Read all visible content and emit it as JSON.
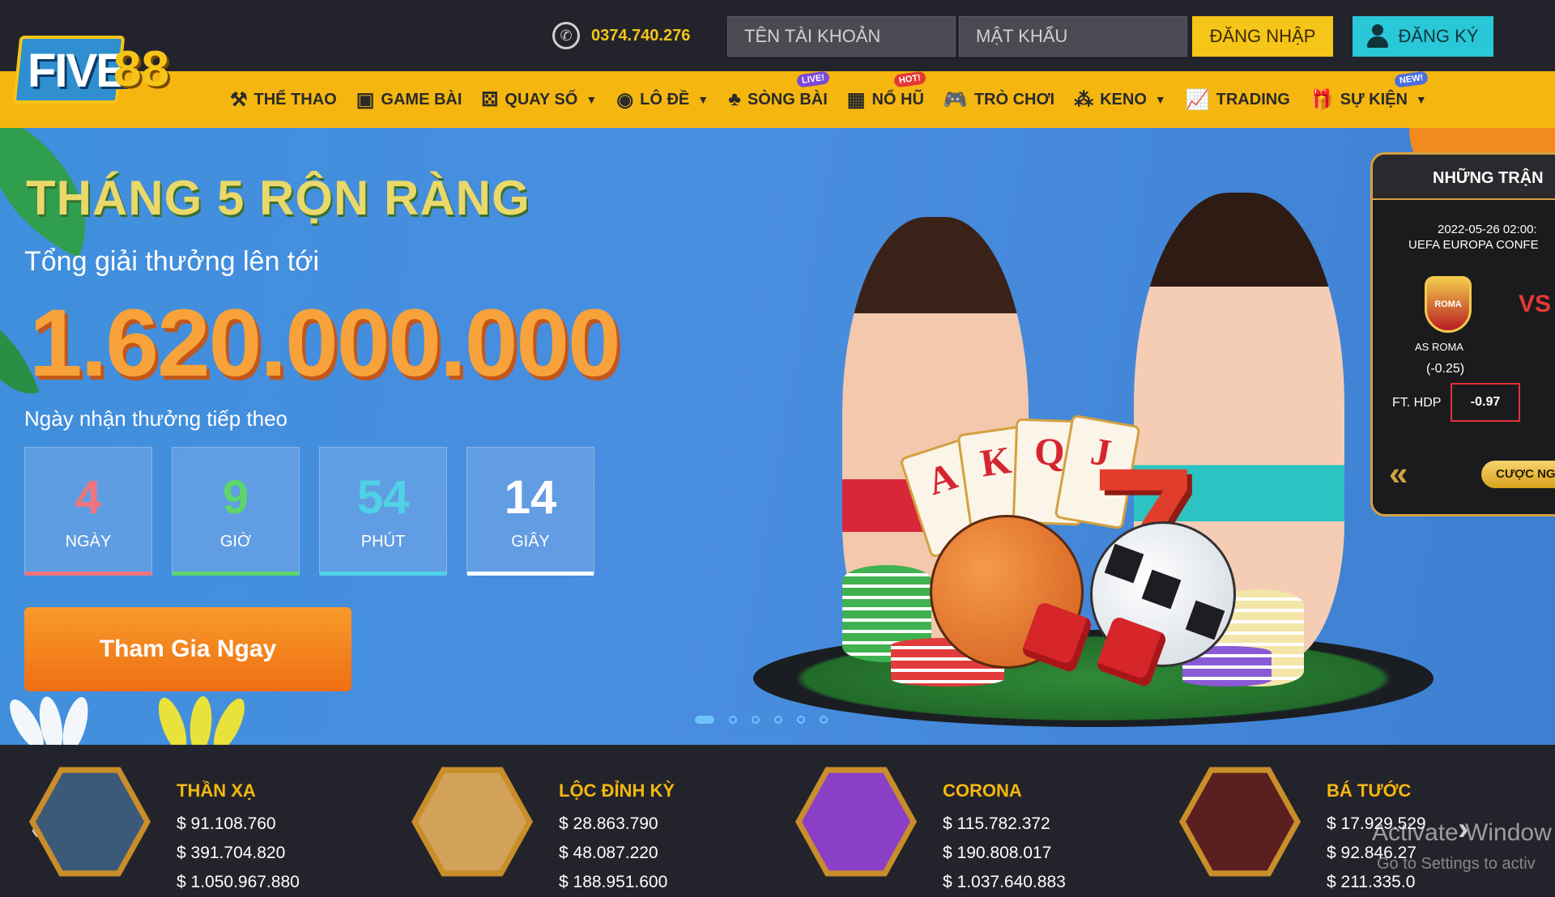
{
  "logo": {
    "part1": "FIVE",
    "part2": "88"
  },
  "header": {
    "phone": "0374.740.276",
    "username_placeholder": "TÊN TÀI KHOẢN",
    "password_placeholder": "MẬT KHẨU",
    "login_label": "ĐĂNG NHẬP",
    "register_label": "ĐĂNG KÝ"
  },
  "nav": {
    "items": [
      {
        "label": "THỂ THAO",
        "icon": "sports-icon"
      },
      {
        "label": "GAME BÀI",
        "icon": "card-games-icon"
      },
      {
        "label": "QUAY SỐ",
        "icon": "lottery-draw-icon"
      },
      {
        "label": "LÔ ĐỀ",
        "icon": "lotto-icon"
      },
      {
        "label": "SÒNG BÀI",
        "icon": "casino-icon",
        "badge": "LIVE!"
      },
      {
        "label": "NỔ HŨ",
        "icon": "slots-icon",
        "badge": "HOT!"
      },
      {
        "label": "TRÒ CHƠI",
        "icon": "gamepad-icon"
      },
      {
        "label": "KENO",
        "icon": "keno-icon"
      },
      {
        "label": "TRADING",
        "icon": "trading-chart-icon"
      },
      {
        "label": "SỰ KIỆN",
        "icon": "gift-icon",
        "badge": "NEW!"
      }
    ]
  },
  "promo": {
    "title": "THÁNG 5 RỘN RÀNG",
    "subtitle": "Tổng giải thưởng lên tới",
    "amount": "1.620.000.000",
    "next_label": "Ngày nhận thưởng tiếp theo",
    "countdown": [
      {
        "value": "4",
        "label": "NGÀY",
        "color": "#f0747c"
      },
      {
        "value": "9",
        "label": "GIỜ",
        "color": "#5cd66a"
      },
      {
        "value": "54",
        "label": "PHÚT",
        "color": "#4fd2e6"
      },
      {
        "value": "14",
        "label": "GIÂY",
        "color": "#ffffff"
      }
    ],
    "cta_label": "Tham Gia Ngay",
    "card_letters": [
      "A",
      "K",
      "Q",
      "J"
    ],
    "seven": "7"
  },
  "match": {
    "header": "NHỮNG TRẬN",
    "datetime": "2022-05-26 02:00:",
    "league": "UEFA EUROPA CONFE",
    "crest_text": "ROMA",
    "vs": "VS",
    "team_home": "AS ROMA",
    "handicap": "(-0.25)",
    "ft_label": "FT. HDP",
    "odds": "-0.97",
    "bet_label": "CƯỢC NG"
  },
  "jackpots": [
    {
      "name": "THẦN XẠ",
      "values": [
        "$ 91.108.760",
        "$ 391.704.820",
        "$ 1.050.967.880"
      ],
      "color": "#3b5a7a"
    },
    {
      "name": "LỘC ĐỈNH KỲ",
      "values": [
        "$ 28.863.790",
        "$ 48.087.220",
        "$ 188.951.600"
      ],
      "color": "#d2a25a"
    },
    {
      "name": "CORONA",
      "values": [
        "$ 115.782.372",
        "$ 190.808.017",
        "$ 1.037.640.883"
      ],
      "color": "#8b3fc7"
    },
    {
      "name": "BÁ TƯỚC",
      "values": [
        "$ 17.929.529",
        "$ 92.846.27",
        "$ 211.335.0"
      ],
      "color": "#5a2020"
    }
  ],
  "watermark": {
    "line1": "Activate Window",
    "line2": "Go to Settings to activ"
  },
  "colors": {
    "nav_bg": "#f5b70f",
    "login_bg": "#f5c518",
    "register_bg": "#29c8d8",
    "hero_bg": "#4a8ee0",
    "cta_bg": "#ef6f12"
  }
}
